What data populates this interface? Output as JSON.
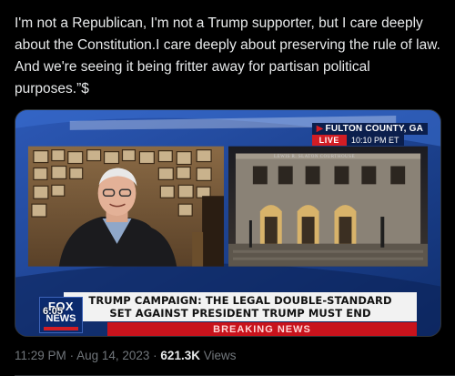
{
  "tweet": {
    "text": "I'm not a Republican, I'm not a Trump supporter, but I care deeply about the Constitution.I care deeply about preserving the rule of law. And we're seeing it being fritter away for partisan political purposes.”$"
  },
  "broadcast": {
    "location": "FULTON COUNTY, GA",
    "live": "LIVE",
    "time": "10:10 PM ET",
    "building_sign": "LEWIS R. SLATON COURTHOUSE",
    "headline_line1": "TRUMP CAMPAIGN: THE LEGAL DOUBLE-STANDARD",
    "headline_line2": "SET AGAINST PRESIDENT TRUMP MUST END",
    "breaking": "BREAKING NEWS",
    "network_logo_line1": "FOX",
    "network_logo_line2": "NEWS",
    "clock": "6:05"
  },
  "meta": {
    "time": "11:29 PM",
    "date": "Aug 14, 2023",
    "views_count": "621.3K",
    "views_label": "Views"
  },
  "colors": {
    "background": "#000000",
    "fox_blue": "#0b2a6e",
    "fox_red": "#d21d24"
  }
}
